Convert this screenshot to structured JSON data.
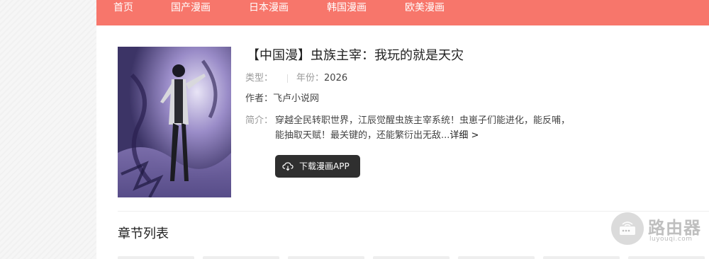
{
  "nav": {
    "items": [
      {
        "label": "首页"
      },
      {
        "label": "国产漫画"
      },
      {
        "label": "日本漫画"
      },
      {
        "label": "韩国漫画"
      },
      {
        "label": "欧美漫画"
      }
    ]
  },
  "comic": {
    "title": "【中国漫】虫族主宰：我玩的就是天灾",
    "type_label": "类型：",
    "type_value": "",
    "year_label": "年份：",
    "year_value": "2026",
    "author_label": "作者：",
    "author_value": "飞卢小说网",
    "intro_label": "简介：",
    "intro_text": "穿越全民转职世界，江辰觉醒虫族主宰系统！虫崽子们能进化，能反哺，能抽取天赋！最关键的，还能繁衍出无敌...",
    "detail_link": "详细 >",
    "download_label": "下载漫画APP"
  },
  "chapters": {
    "title": "章节列表"
  },
  "watermark": {
    "text": "路由器",
    "sub": "luyouqi.com"
  },
  "colors": {
    "nav_bg": "#f7766b",
    "button_bg": "#2f2f2f"
  }
}
